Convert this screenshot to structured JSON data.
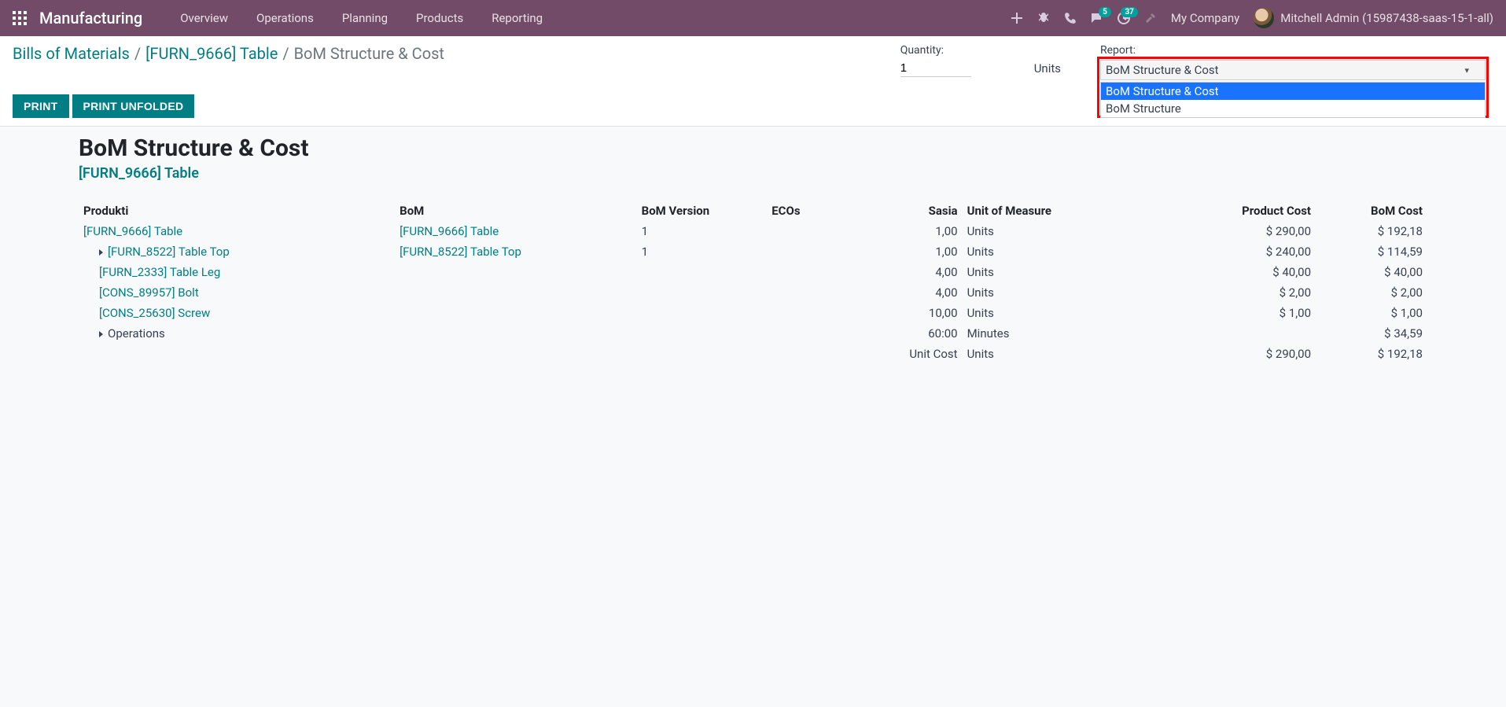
{
  "navbar": {
    "app_name": "Manufacturing",
    "menu": [
      "Overview",
      "Operations",
      "Planning",
      "Products",
      "Reporting"
    ],
    "chat_badge": "5",
    "activity_badge": "37",
    "company": "My Company",
    "user": "Mitchell Admin (15987438-saas-15-1-all)"
  },
  "breadcrumb": {
    "a": "Bills of Materials",
    "b": "[FURN_9666] Table",
    "c": "BoM Structure & Cost"
  },
  "controls": {
    "qty_label": "Quantity:",
    "qty_value": "1",
    "unit": "Units",
    "report_label": "Report:",
    "report_selected": "BoM Structure & Cost",
    "report_options": [
      "BoM Structure & Cost",
      "BoM Structure"
    ],
    "print": "PRINT",
    "print_unfolded": "PRINT UNFOLDED"
  },
  "report": {
    "title": "BoM Structure & Cost",
    "subtitle": "[FURN_9666] Table",
    "headers": {
      "product": "Produkti",
      "bom": "BoM",
      "version": "BoM Version",
      "ecos": "ECOs",
      "qty": "Sasia",
      "uom": "Unit of Measure",
      "pcost": "Product Cost",
      "bcost": "BoM Cost"
    },
    "rows": [
      {
        "indent": 0,
        "caret": false,
        "product": "[FURN_9666] Table",
        "link": true,
        "bom": "[FURN_9666] Table",
        "bom_link": true,
        "version": "1",
        "ecos": "",
        "qty": "1,00",
        "uom": "Units",
        "pcost": "$ 290,00",
        "bcost": "$ 192,18"
      },
      {
        "indent": 1,
        "caret": true,
        "product": "[FURN_8522] Table Top",
        "link": true,
        "bom": "[FURN_8522] Table Top",
        "bom_link": true,
        "version": "1",
        "ecos": "",
        "qty": "1,00",
        "uom": "Units",
        "pcost": "$ 240,00",
        "bcost": "$ 114,59"
      },
      {
        "indent": 1,
        "caret": false,
        "product": "[FURN_2333] Table Leg",
        "link": true,
        "bom": "",
        "bom_link": false,
        "version": "",
        "ecos": "",
        "qty": "4,00",
        "uom": "Units",
        "pcost": "$ 40,00",
        "bcost": "$ 40,00"
      },
      {
        "indent": 1,
        "caret": false,
        "product": "[CONS_89957] Bolt",
        "link": true,
        "bom": "",
        "bom_link": false,
        "version": "",
        "ecos": "",
        "qty": "4,00",
        "uom": "Units",
        "pcost": "$ 2,00",
        "bcost": "$ 2,00"
      },
      {
        "indent": 1,
        "caret": false,
        "product": "[CONS_25630] Screw",
        "link": true,
        "bom": "",
        "bom_link": false,
        "version": "",
        "ecos": "",
        "qty": "10,00",
        "uom": "Units",
        "pcost": "$ 1,00",
        "bcost": "$ 1,00"
      },
      {
        "indent": 1,
        "caret": true,
        "product": "Operations",
        "link": false,
        "bom": "",
        "bom_link": false,
        "version": "",
        "ecos": "",
        "qty": "60:00",
        "uom": "Minutes",
        "pcost": "",
        "bcost": "$ 34,59"
      }
    ],
    "footer": {
      "label": "Unit Cost",
      "uom": "Units",
      "pcost": "$ 290,00",
      "bcost": "$ 192,18"
    }
  }
}
